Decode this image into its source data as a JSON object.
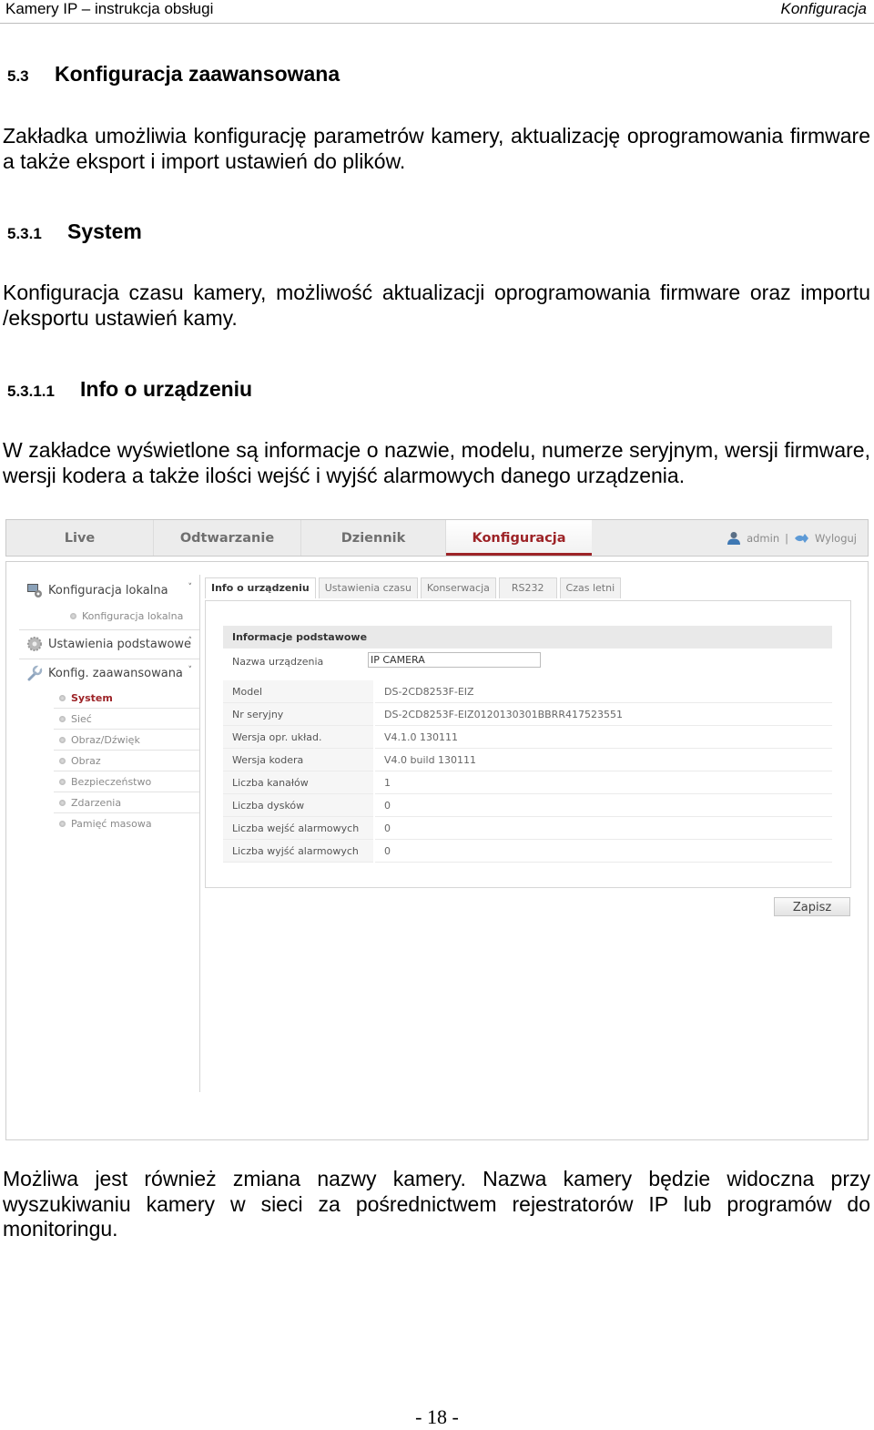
{
  "page_header": {
    "left": "Kamery IP – instrukcja obsługi",
    "right": "Konfiguracja"
  },
  "sections": {
    "s53": {
      "num": "5.3",
      "title": "Konfiguracja zaawansowana",
      "text": "Zakładka umożliwia konfigurację parametrów kamery, aktualizację oprogramowania firmware a także eksport i import ustawień do plików."
    },
    "s531": {
      "num": "5.3.1",
      "title": "System",
      "text": "Konfiguracja czasu kamery, możliwość aktualizacji oprogramowania firmware oraz importu /eksportu ustawień kamy."
    },
    "s5311": {
      "num": "5.3.1.1",
      "title": "Info o urządzeniu",
      "text": "W zakładce wyświetlone są informacje o nazwie, modelu, numerze seryjnym, wersji firmware, wersji kodera a także ilości wejść i wyjść alarmowych danego urządzenia."
    }
  },
  "ui": {
    "nav_tabs": [
      "Live",
      "Odtwarzanie",
      "Dziennik",
      "Konfiguracja"
    ],
    "active_nav": "Konfiguracja",
    "user": {
      "name": "admin",
      "separator": "|",
      "logout": "Wyloguj"
    },
    "sidebar": {
      "local": {
        "label": "Konfiguracja lokalna",
        "chevron": "˅",
        "items": [
          "Konfiguracja lokalna"
        ]
      },
      "basic": {
        "label": "Ustawienia podstawowe",
        "chevron": "˄"
      },
      "advanced": {
        "label": "Konfig. zaawansowana",
        "chevron": "˅",
        "items": [
          "System",
          "Sieć",
          "Obraz/Dźwięk",
          "Obraz",
          "Bezpieczeństwo",
          "Zdarzenia",
          "Pamięć masowa"
        ],
        "active": "System"
      }
    },
    "subtabs": [
      "Info o urządzeniu",
      "Ustawienia czasu",
      "Konserwacja",
      "RS232",
      "Czas letni"
    ],
    "panel_title": "Informacje podstawowe",
    "device_name": {
      "label": "Nazwa urządzenia",
      "value": "IP CAMERA"
    },
    "info_rows": [
      {
        "label": "Model",
        "value": "DS-2CD8253F-EIZ"
      },
      {
        "label": "Nr seryjny",
        "value": "DS-2CD8253F-EIZ0120130301BBRR417523551"
      },
      {
        "label": "Wersja opr. układ.",
        "value": "V4.1.0 130111"
      },
      {
        "label": "Wersja kodera",
        "value": "V4.0 build 130111"
      },
      {
        "label": "Liczba kanałów",
        "value": "1"
      },
      {
        "label": "Liczba dysków",
        "value": "0"
      },
      {
        "label": "Liczba wejść alarmowych",
        "value": "0"
      },
      {
        "label": "Liczba wyjść alarmowych",
        "value": "0"
      }
    ],
    "save_label": "Zapisz"
  },
  "closing_text": "Możliwa jest również zmiana nazwy kamery. Nazwa kamery będzie widoczna przy wyszukiwaniu kamery w sieci za pośrednictwem rejestratorów IP lub programów do monitoringu.",
  "page_number": "- 18 -",
  "colors": {
    "accent": "#9d2327",
    "nav_bg": "#ececec"
  }
}
